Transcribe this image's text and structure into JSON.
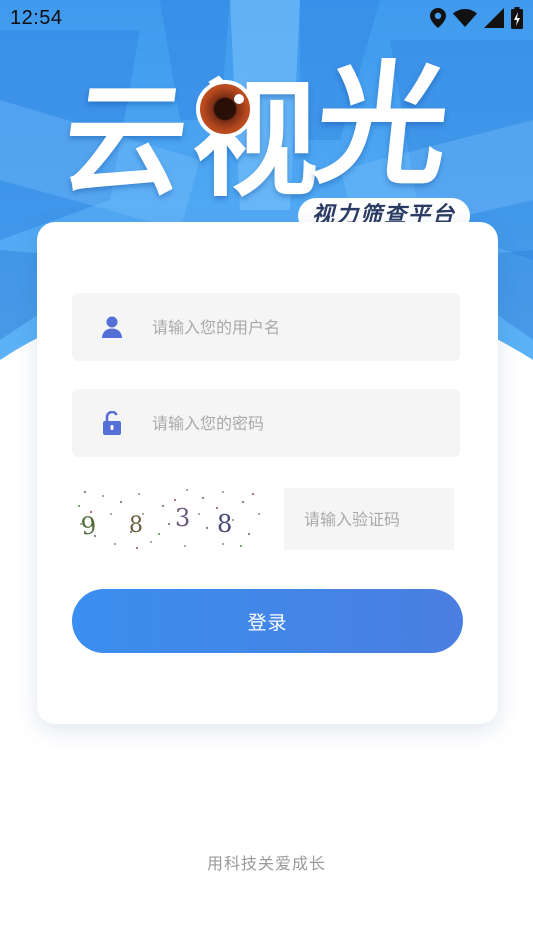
{
  "status_bar": {
    "time": "12:54",
    "icons": [
      "location-icon",
      "wifi-icon",
      "signal-icon",
      "battery-charging-icon"
    ]
  },
  "logo": {
    "chars": [
      "云",
      "视",
      "光"
    ],
    "subtitle": "视力筛查平台"
  },
  "form": {
    "username_placeholder": "请输入您的用户名",
    "password_placeholder": "请输入您的密码",
    "captcha_code": [
      "9",
      "8",
      "3",
      "8"
    ],
    "captcha_placeholder": "请输入验证码",
    "login_label": "登录"
  },
  "footer": {
    "slogan": "用科技关爱成长"
  },
  "colors": {
    "primary": "#3a8ff0",
    "icon": "#5470d6",
    "hero_blue": "#4aa3f2"
  }
}
